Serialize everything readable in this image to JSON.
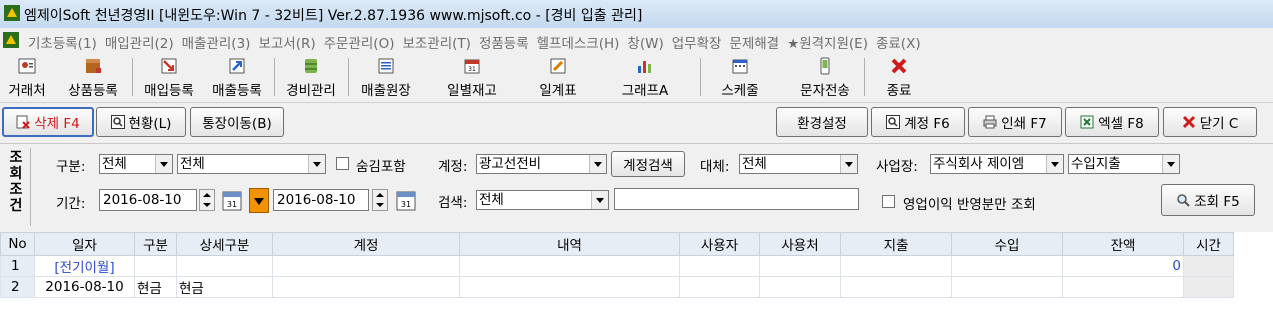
{
  "window": {
    "title": "엠제이Soft 천년경영II [내윈도우:Win 7 - 32비트] Ver.2.87.1936        www.mjsoft.co - [경비 입출 관리]"
  },
  "menu": {
    "items": [
      "기초등록(1)",
      "매입관리(2)",
      "매출관리(3)",
      "보고서(R)",
      "주문관리(O)",
      "보조관리(T)",
      "정품등록",
      "헬프데스크(H)",
      "창(W)",
      "업무확장",
      "문제해결",
      "★원격지원(E)",
      "종료(X)"
    ]
  },
  "toolbar": {
    "customer": "거래처",
    "product": "상품등록",
    "purchase": "매입등록",
    "sales": "매출등록",
    "expense": "경비관리",
    "sales_ledger": "매출원장",
    "daily_stock": "일별재고",
    "daily_table": "일계표",
    "graph": "그래프A",
    "schedule": "스케줄",
    "sms": "문자전송",
    "exit": "종료"
  },
  "actions": {
    "delete": "삭제 F4",
    "status": "현황(L)",
    "account_move": "통장이동(B)",
    "settings": "환경설정",
    "account": "계정 F6",
    "print": "인쇄 F7",
    "excel": "엑셀 F8",
    "close": "닫기 C"
  },
  "conditions": {
    "section_label": "조회조건",
    "category_label": "구분:",
    "category_value": "전체",
    "subcategory_value": "전체",
    "include_hidden_label": "숨김포함",
    "account_label": "계정:",
    "account_value": "광고선전비",
    "account_search_button": "계정검색",
    "substitute_label": "대체:",
    "substitute_value": "전체",
    "business_label": "사업장:",
    "business_value": "주식회사 제이엠",
    "business_type_value": "수입지출",
    "period_label": "기간:",
    "date_from": "2016-08-10",
    "date_to": "2016-08-10",
    "search_label": "검색:",
    "search_type_value": "전체",
    "search_text": "",
    "operating_profit_label": "영업이익 반영분만 조회",
    "query_button": "조회 F5"
  },
  "grid": {
    "headers": [
      "No",
      "일자",
      "구분",
      "상세구분",
      "계정",
      "내역",
      "사용자",
      "사용처",
      "지출",
      "수입",
      "잔액",
      "시간"
    ],
    "rows": [
      {
        "no": "1",
        "date": "[전기이월]",
        "type": "",
        "detail": "",
        "account": "",
        "desc": "",
        "user": "",
        "place": "",
        "out": "",
        "in": "",
        "balance": "0",
        "time": ""
      },
      {
        "no": "2",
        "date": "2016-08-10",
        "type": "현금",
        "detail": "현금",
        "account": "",
        "desc": "",
        "user": "",
        "place": "",
        "out": "",
        "in": "",
        "balance": "",
        "time": ""
      }
    ]
  }
}
